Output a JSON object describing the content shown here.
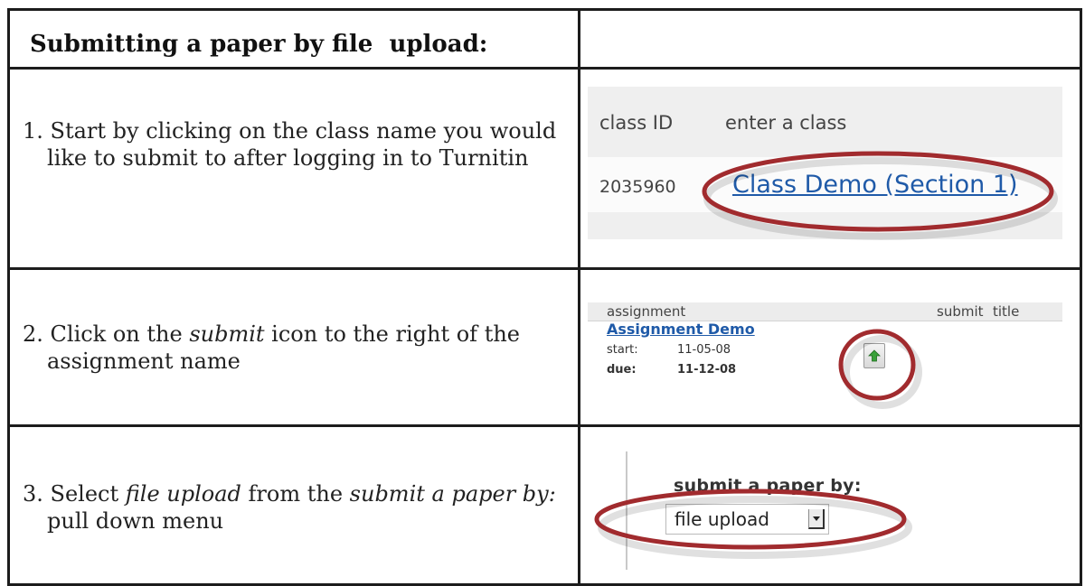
{
  "table": {
    "header": {
      "title": "Submitting a paper by file  upload:"
    },
    "rows": [
      {
        "instruction_parts": [
          "1. Start by clicking on the class name you would like to submit to after logging in to Turnitin"
        ],
        "screenshot": {
          "col_class_id": "class ID",
          "col_enter_class": "enter a class",
          "class_id": "2035960",
          "class_name": "Class Demo (Section 1)"
        }
      },
      {
        "instruction_parts": [
          "2. Click on the ",
          "submit",
          " icon to the right of the assignment name"
        ],
        "screenshot": {
          "col_assignment": "assignment",
          "col_submit": "submit",
          "col_title": "title",
          "assignment_name": "Assignment Demo",
          "start_label": "start:",
          "start_date": "11-05-08",
          "due_label": "due:",
          "due_date": "11-12-08",
          "icon": "upload-arrow-icon"
        }
      },
      {
        "instruction_parts": [
          "3. Select ",
          "file upload",
          " from the ",
          "submit a paper by:",
          " pull down menu"
        ],
        "screenshot": {
          "label": "submit a paper by:",
          "selected_option": "file upload"
        }
      }
    ]
  },
  "colors": {
    "highlight_ellipse": "#a12b2e",
    "link": "#1f5aa8",
    "upload_arrow": "#3aa13a"
  }
}
